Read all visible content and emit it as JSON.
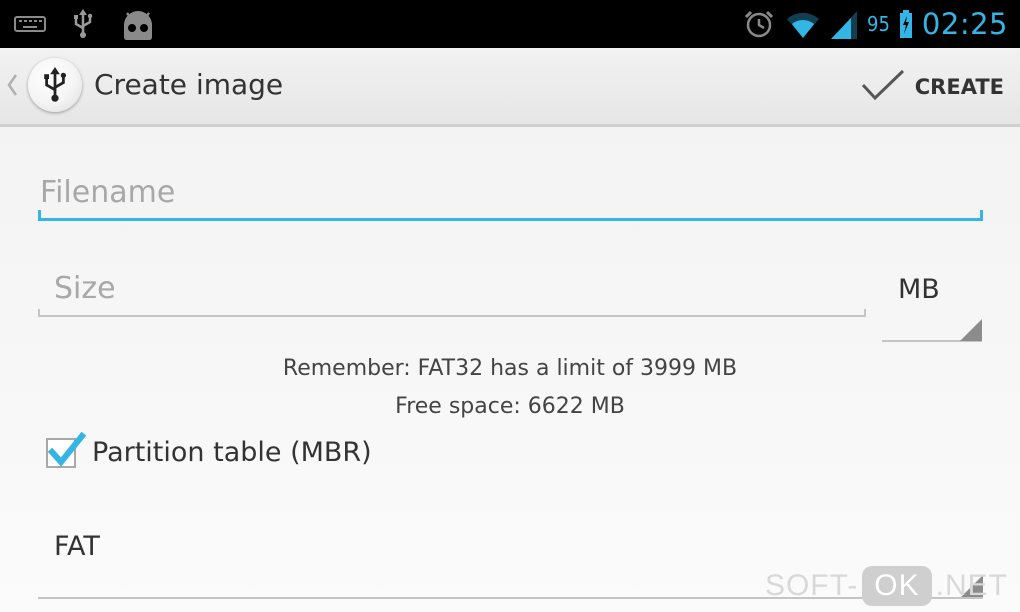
{
  "status_bar": {
    "battery_percent": "95",
    "time": "02:25",
    "left_icons": [
      "keyboard-icon",
      "usb-icon",
      "android-robot-icon"
    ],
    "right_icons": [
      "alarm-icon",
      "wifi-icon",
      "signal-icon",
      "battery-icon"
    ]
  },
  "action_bar": {
    "title": "Create image",
    "app_icon": "usb-icon",
    "create_label": "CREATE"
  },
  "form": {
    "filename_placeholder": "Filename",
    "filename_value": "",
    "size_placeholder": "Size",
    "size_value": "",
    "size_unit": "MB",
    "fat32_hint": "Remember: FAT32 has a limit of 3999 MB",
    "free_space": "Free space: 6622 MB",
    "partition_table_label": "Partition table (MBR)",
    "partition_table_checked": true,
    "filesystem": "FAT"
  },
  "watermark": {
    "left": "SOFT-",
    "middle": "OK",
    "right": ".NET"
  },
  "colors": {
    "accent": "#33b5e5",
    "status_bar_bg": "#000000",
    "action_bar_bg": "#e9e9e9"
  }
}
